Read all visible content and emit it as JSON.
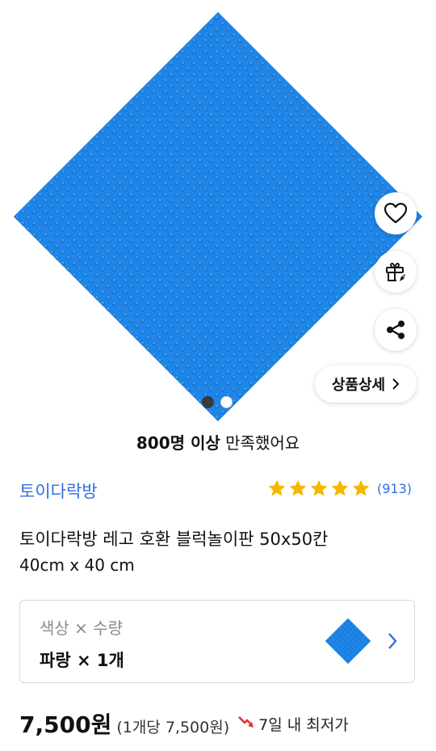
{
  "colors": {
    "accent": "#2f6fe0",
    "star": "#f5b700",
    "plate": "#1e86e8",
    "hot_icon": "#e8322b"
  },
  "hero": {
    "icons": [
      "heart-icon",
      "gift-icon",
      "share-icon"
    ],
    "detail_button": "상품상세",
    "carousel": {
      "total": 2,
      "active_index": 1
    }
  },
  "satisfaction": {
    "bold": "800명 이상",
    "rest": "만족했어요"
  },
  "product": {
    "brand": "토이다락방",
    "rating": {
      "stars": 5,
      "count": "(913)"
    },
    "title": "토이다락방 레고 호환 블럭놀이판 50x50칸",
    "subtitle": "40cm x 40 cm"
  },
  "option": {
    "label": "색상 × 수량",
    "value": "파랑 × 1개"
  },
  "price": {
    "amount": "7,500원",
    "per_unit": "(1개당 7,500원)",
    "lowest": "7일 내 최저가"
  }
}
